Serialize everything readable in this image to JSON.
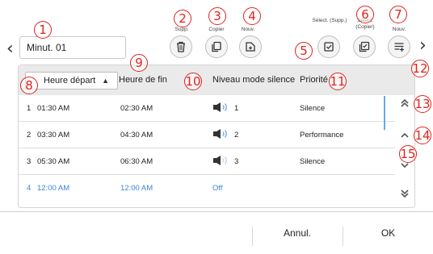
{
  "header": {
    "timer_name": "Minut. 01",
    "buttons": {
      "delete_label": "Supp.",
      "copy_label": "Copier",
      "new_label": "Nouv.",
      "select_delete_label": "Sélect. (Supp.)",
      "select_copy_label": "Sélect. (Copier)",
      "add_label": "Nouv."
    }
  },
  "table": {
    "columns": {
      "start": "Heure départ",
      "end": "Heure de fin",
      "level": "Niveau mode silence",
      "priority": "Priorité"
    },
    "rows": [
      {
        "num": "1",
        "start": "01:30 AM",
        "end": "02:30 AM",
        "level": "1",
        "priority": "Silence"
      },
      {
        "num": "2",
        "start": "03:30 AM",
        "end": "04:30 AM",
        "level": "2",
        "priority": "Performance"
      },
      {
        "num": "3",
        "start": "05:30 AM",
        "end": "06:30 AM",
        "level": "3",
        "priority": "Silence"
      },
      {
        "num": "4",
        "start": "12:00 AM",
        "end": "12:00 AM",
        "level": "Off",
        "priority": ""
      }
    ]
  },
  "footer": {
    "cancel_label": "Annul.",
    "ok_label": "OK"
  },
  "annotations": [
    "1",
    "2",
    "3",
    "4",
    "5",
    "6",
    "7",
    "8",
    "9",
    "10",
    "11",
    "12",
    "13",
    "14",
    "15"
  ],
  "colors": {
    "annotation": "#e0231b",
    "highlight_row": "#3a86d6",
    "scroll_indicator": "#6aa7e6"
  },
  "icons": [
    "chevron-left-icon",
    "chevron-right-icon",
    "trash-icon",
    "copy-icon",
    "add-file-icon",
    "select-delete-icon",
    "select-copy-icon",
    "add-list-icon",
    "sort-up-icon",
    "speaker-icon",
    "double-up-icon",
    "up-icon",
    "down-icon",
    "double-down-icon"
  ]
}
